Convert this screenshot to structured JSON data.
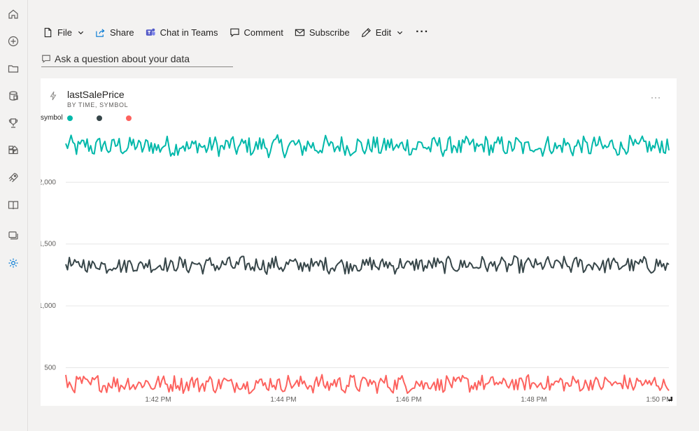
{
  "rail": {
    "items": [
      {
        "name": "home-icon",
        "label": "Home"
      },
      {
        "name": "create-icon",
        "label": "Create"
      },
      {
        "name": "browse-icon",
        "label": "Browse"
      },
      {
        "name": "data-hub-icon",
        "label": "Data hub"
      },
      {
        "name": "metrics-icon",
        "label": "Metrics"
      },
      {
        "name": "apps-icon",
        "label": "Apps"
      },
      {
        "name": "learn-icon",
        "label": "Learn"
      },
      {
        "name": "workspaces-icon",
        "label": "Workspaces"
      },
      {
        "name": "deployment-icon",
        "label": "Deployment"
      },
      {
        "name": "settings-icon",
        "label": "Settings"
      }
    ]
  },
  "toolbar": {
    "file_label": "File",
    "share_label": "Share",
    "teams_label": "Chat in Teams",
    "comment_label": "Comment",
    "subscribe_label": "Subscribe",
    "edit_label": "Edit",
    "more_label": "···"
  },
  "qa": {
    "placeholder": "Ask a question about your data"
  },
  "visual": {
    "title": "lastSalePrice",
    "subtitle": "BY TIME, SYMBOL",
    "more_label": "···",
    "legend_title": "symbol"
  },
  "colors": {
    "series1": "#01B8AA",
    "series2": "#374649",
    "series3": "#FD625E"
  },
  "chart_data": {
    "type": "line",
    "title": "lastSalePrice",
    "subtitle": "BY TIME, SYMBOL",
    "legend_title": "symbol",
    "legend_position": "top-left",
    "x_ticks": [
      "1:42 PM",
      "1:44 PM",
      "1:46 PM",
      "1:48 PM",
      "1:50 PM"
    ],
    "y_ticks": [
      500,
      1000,
      1500,
      2000
    ],
    "y_tick_labels": [
      "500",
      "1,000",
      "1,500",
      "2,000"
    ],
    "ylim": [
      350,
      2500
    ],
    "x_range_minutes": [
      "1:40:30 PM",
      "1:50 PM"
    ],
    "grid": true,
    "series": [
      {
        "color": "#01B8AA",
        "mean": 2290,
        "range": [
          2195,
          2380
        ]
      },
      {
        "color": "#374649",
        "mean": 1330,
        "range": [
          1260,
          1410
        ]
      },
      {
        "color": "#FD625E",
        "mean": 370,
        "range": [
          290,
          450
        ]
      }
    ]
  }
}
